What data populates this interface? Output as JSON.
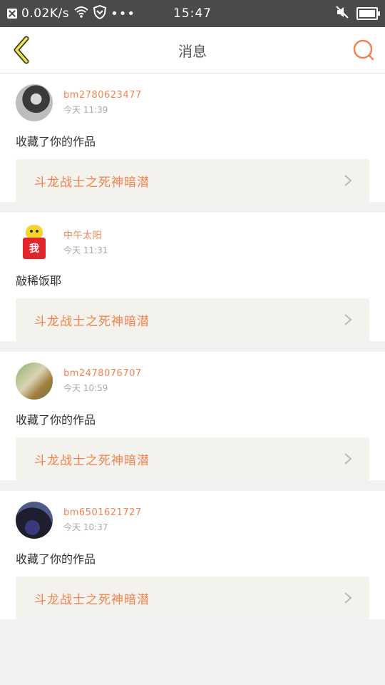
{
  "status_bar": {
    "speed": "0.02K/s",
    "time": "15:47",
    "icons": [
      "notification-icon",
      "wifi-icon",
      "shield-icon",
      "more-dots-icon",
      "mute-icon",
      "battery-icon"
    ]
  },
  "header": {
    "title": "消息",
    "accent_color": "#f0834f"
  },
  "messages": [
    {
      "username": "bm2780623477",
      "time": "今天 11:39",
      "text": "收藏了你的作品",
      "work_title": "斗龙战士之死神暗潜"
    },
    {
      "username": "中午太阳",
      "time": "今天 11:31",
      "text": "敲稀饭耶",
      "work_title": "斗龙战士之死神暗潜",
      "avatar_text": "我"
    },
    {
      "username": "bm2478076707",
      "time": "今天 10:59",
      "text": "收藏了你的作品",
      "work_title": "斗龙战士之死神暗潜"
    },
    {
      "username": "bm6501621727",
      "time": "今天 10:37",
      "text": "收藏了你的作品",
      "work_title": "斗龙战士之死神暗潜"
    }
  ]
}
